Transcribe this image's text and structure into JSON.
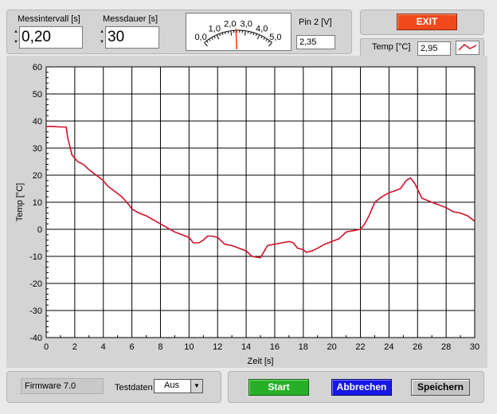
{
  "controls": {
    "messintervall": {
      "label": "Messintervall [s]",
      "value": "0,20"
    },
    "messdauer": {
      "label": "Messdauer [s]",
      "value": "30"
    }
  },
  "gauge": {
    "ticks": [
      "0,0",
      "1,0",
      "2,0",
      "3,0",
      "4,0",
      "5,0"
    ],
    "value": 2.35
  },
  "pin2": {
    "label": "Pin 2 [V]",
    "value": "2,35"
  },
  "exit_label": "EXIT",
  "legend": {
    "label": "Temp [°C]",
    "value": "2,95"
  },
  "footer": {
    "firmware": "Firmware 7.0",
    "testdaten_label": "Testdaten",
    "testdaten_value": "Aus",
    "start_label": "Start",
    "abbrechen_label": "Abbrechen",
    "speichern_label": "Speichern"
  },
  "colors": {
    "series": "#d0102a",
    "plot_bg": "#ffffff",
    "grid": "#000000",
    "exit": "#f04a1c",
    "start": "#27b027",
    "abbrechen": "#1717e6"
  },
  "chart_data": {
    "type": "line",
    "xlabel": "Zeit [s]",
    "ylabel": "Temp [°C]",
    "xlim": [
      0,
      30
    ],
    "ylim": [
      -40,
      60
    ],
    "xticks": [
      0,
      2,
      4,
      6,
      8,
      10,
      12,
      14,
      16,
      18,
      20,
      22,
      24,
      26,
      28,
      30
    ],
    "yticks": [
      -40,
      -30,
      -20,
      -10,
      0,
      10,
      20,
      30,
      40,
      50,
      60
    ],
    "grid": true,
    "series": [
      {
        "name": "Temp [°C]",
        "x": [
          0,
          0.5,
          1.0,
          1.4,
          1.5,
          1.8,
          2.2,
          2.6,
          3.0,
          3.5,
          4.0,
          4.3,
          4.8,
          5.3,
          5.8,
          6.0,
          6.5,
          7.0,
          7.5,
          8.0,
          8.5,
          9.0,
          9.5,
          10.0,
          10.3,
          10.7,
          11.0,
          11.3,
          11.6,
          12.0,
          12.5,
          13.0,
          13.5,
          14.0,
          14.4,
          15.0,
          15.5,
          16.0,
          16.5,
          17.0,
          17.3,
          17.6,
          18.0,
          18.2,
          18.6,
          19.0,
          19.5,
          20.0,
          20.5,
          21.0,
          21.5,
          22.0,
          22.3,
          22.6,
          23.0,
          23.5,
          24.0,
          24.3,
          24.8,
          25.2,
          25.5,
          25.8,
          26.3,
          27.0,
          27.5,
          28.0,
          28.5,
          29.0,
          29.5,
          30.0
        ],
        "y": [
          38,
          38,
          37.8,
          37.8,
          34,
          27.5,
          25,
          24,
          22,
          20,
          18,
          16,
          14,
          12,
          9,
          7.5,
          6,
          5,
          3.5,
          2,
          0.5,
          -1,
          -2,
          -3,
          -5,
          -5,
          -4,
          -2.5,
          -2.5,
          -3,
          -5.5,
          -6,
          -7,
          -8,
          -10,
          -10.5,
          -6,
          -5.5,
          -5,
          -4.5,
          -5,
          -7,
          -7.5,
          -8.5,
          -8,
          -7,
          -5.5,
          -4.5,
          -3.5,
          -1,
          -0.5,
          0,
          2,
          5,
          10,
          12,
          13.5,
          14,
          15,
          18,
          19,
          17,
          11.5,
          10,
          9,
          8,
          6.5,
          6,
          5,
          3
        ]
      }
    ]
  }
}
